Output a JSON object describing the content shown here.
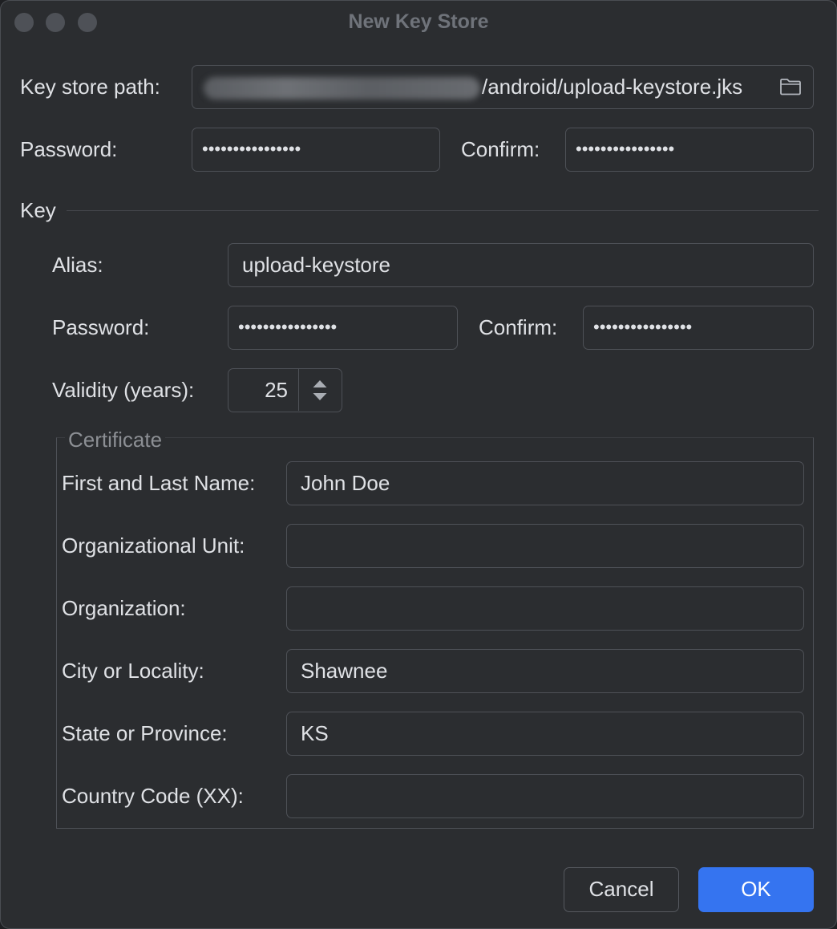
{
  "window": {
    "title": "New Key Store"
  },
  "keystore": {
    "path_label": "Key store path:",
    "path_visible_suffix": "/android/upload-keystore.jks",
    "password_label": "Password:",
    "password_value": "••••••••••••••••",
    "confirm_label": "Confirm:",
    "confirm_value": "••••••••••••••••"
  },
  "key": {
    "section_label": "Key",
    "alias_label": "Alias:",
    "alias_value": "upload-keystore",
    "password_label": "Password:",
    "password_value": "••••••••••••••••",
    "confirm_label": "Confirm:",
    "confirm_value": "••••••••••••••••",
    "validity_label": "Validity (years):",
    "validity_value": "25"
  },
  "certificate": {
    "legend": "Certificate",
    "fields": [
      {
        "label": "First and Last Name:",
        "value": "John Doe"
      },
      {
        "label": "Organizational Unit:",
        "value": ""
      },
      {
        "label": "Organization:",
        "value": ""
      },
      {
        "label": "City or Locality:",
        "value": "Shawnee"
      },
      {
        "label": "State or Province:",
        "value": "KS"
      },
      {
        "label": "Country Code (XX):",
        "value": ""
      }
    ]
  },
  "buttons": {
    "cancel": "Cancel",
    "ok": "OK"
  },
  "colors": {
    "background": "#2b2d30",
    "accent": "#3574f0",
    "text": "#dfe1e5",
    "border": "#4e5157"
  },
  "icons": {
    "browse": "folder-icon",
    "spinner": "up-down-arrows-icon"
  }
}
